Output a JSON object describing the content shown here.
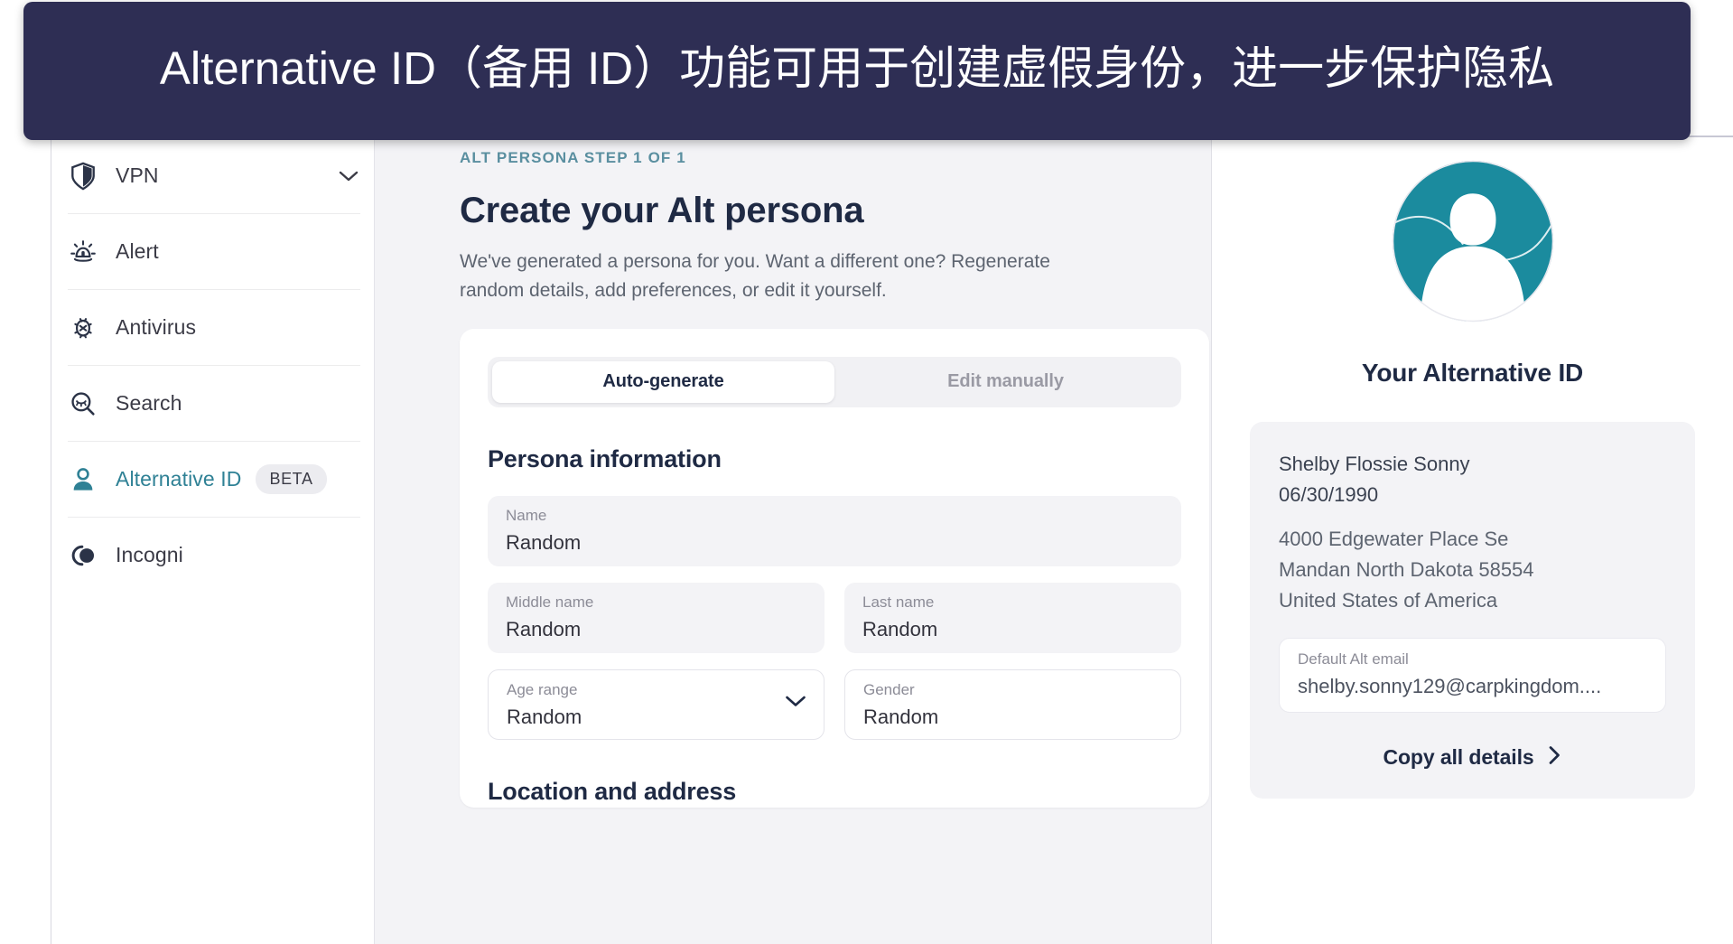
{
  "banner": {
    "text": "Alternative ID（备用 ID）功能可用于创建虚假身份，进一步保护隐私",
    "bg_color": "#2e2e54",
    "text_color": "#ffffff"
  },
  "sidebar": {
    "items": [
      {
        "label": "VPN",
        "icon": "shield-icon",
        "active": false,
        "has_chevron": true,
        "badge": ""
      },
      {
        "label": "Alert",
        "icon": "siren-icon",
        "active": false,
        "has_chevron": false,
        "badge": ""
      },
      {
        "label": "Antivirus",
        "icon": "bug-icon",
        "active": false,
        "has_chevron": false,
        "badge": ""
      },
      {
        "label": "Search",
        "icon": "private-search-icon",
        "active": false,
        "has_chevron": false,
        "badge": ""
      },
      {
        "label": "Alternative ID",
        "icon": "person-icon",
        "active": true,
        "has_chevron": false,
        "badge": "BETA"
      },
      {
        "label": "Incogni",
        "icon": "incogni-icon",
        "active": false,
        "has_chevron": false,
        "badge": ""
      }
    ],
    "active_color": "#2f8195"
  },
  "main": {
    "eyebrow": "ALT PERSONA STEP 1 OF 1",
    "title": "Create your Alt persona",
    "subtitle": "We've generated a persona for you. Want a different one? Regenerate random details, add preferences, or edit it yourself.",
    "tabs": [
      {
        "label": "Auto-generate",
        "active": true
      },
      {
        "label": "Edit manually",
        "active": false
      }
    ],
    "sections": [
      {
        "title": "Persona information",
        "rows": [
          [
            {
              "label": "Name",
              "value": "Random",
              "style": "filled",
              "chevron": false
            }
          ],
          [
            {
              "label": "Middle name",
              "value": "Random",
              "style": "filled",
              "chevron": false
            },
            {
              "label": "Last name",
              "value": "Random",
              "style": "filled",
              "chevron": false
            }
          ],
          [
            {
              "label": "Age range",
              "value": "Random",
              "style": "outline",
              "chevron": true
            },
            {
              "label": "Gender",
              "value": "Random",
              "style": "outline",
              "chevron": false
            }
          ]
        ]
      },
      {
        "title": "Location and address",
        "rows": []
      }
    ]
  },
  "right_panel": {
    "avatar_icon": "person-avatar-icon",
    "avatar_color": "#1b8b9e",
    "title": "Your Alternative ID",
    "identity": {
      "name": "Shelby Flossie Sonny",
      "birthdate": "06/30/1990",
      "address_line1": "4000 Edgewater Place Se",
      "address_line2": "Mandan North Dakota 58554",
      "address_line3": "United States of America",
      "email_label": "Default Alt email",
      "email_value": "shelby.sonny129@carpkingdom...."
    },
    "copy_button": {
      "label": "Copy all details",
      "icon": "chevron-right-icon"
    }
  }
}
